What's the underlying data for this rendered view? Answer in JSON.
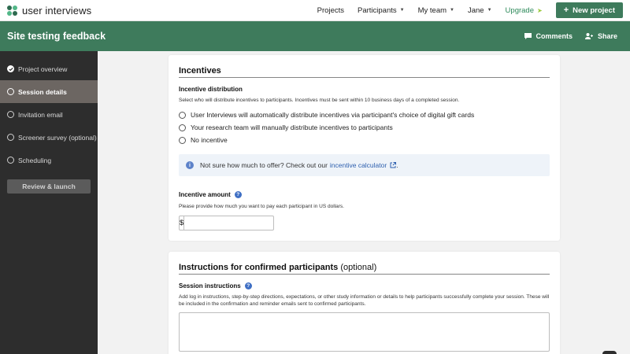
{
  "brand": {
    "name": "user interviews"
  },
  "nav": {
    "items": [
      {
        "label": "Projects",
        "has_caret": false
      },
      {
        "label": "Participants",
        "has_caret": true
      },
      {
        "label": "My team",
        "has_caret": true
      },
      {
        "label": "Jane",
        "has_caret": true
      }
    ],
    "upgrade_label": "Upgrade",
    "new_project_label": "New project"
  },
  "project": {
    "title": "Site testing feedback",
    "comments_label": "Comments",
    "share_label": "Share"
  },
  "sidebar": {
    "items": [
      {
        "label": "Project overview",
        "state": "done"
      },
      {
        "label": "Session details",
        "state": "active"
      },
      {
        "label": "Invitation email",
        "state": "todo"
      },
      {
        "label": "Screener survey (optional)",
        "state": "todo"
      },
      {
        "label": "Scheduling",
        "state": "todo"
      }
    ],
    "review_label": "Review & launch"
  },
  "incentives": {
    "title": "Incentives",
    "distribution_label": "Incentive distribution",
    "distribution_help": "Select who will distribute incentives to participants. Incentives must be sent within 10 business days of a completed session.",
    "options": [
      "User Interviews will automatically distribute incentives via participant's choice of digital gift cards",
      "Your research team will manually distribute incentives to participants",
      "No incentive"
    ],
    "info_text": "Not sure how much to offer? Check out our",
    "info_link": "incentive calculator",
    "info_suffix": ".",
    "amount_label": "Incentive amount",
    "amount_help": "Please provide how much you want to pay each participant in US dollars.",
    "currency_symbol": "$",
    "amount_value": ""
  },
  "instructions": {
    "title": "Instructions for confirmed participants",
    "title_suffix": "(optional)",
    "session_label": "Session instructions",
    "session_help": "Add log in instructions, step-by-step directions, expectations, or other study information or details to help participants successfully complete your session. These will be included in the confirmation and reminder emails sent to confirmed participants.",
    "session_value": ""
  },
  "colors": {
    "brand_green": "#3e7b5c",
    "sidebar_bg": "#2d2d2d",
    "sidebar_active": "#6c6662",
    "link_blue": "#2d5fae"
  }
}
